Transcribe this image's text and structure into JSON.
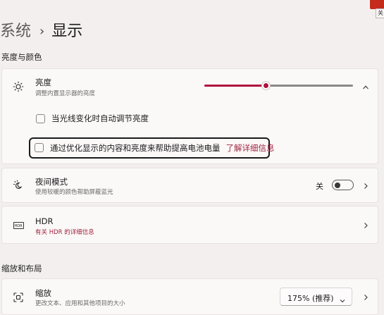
{
  "window": {
    "mini_label": "关"
  },
  "breadcrumb": {
    "parent": "系统",
    "separator": "›",
    "current": "显示"
  },
  "sections": {
    "brightness_color": "亮度与颜色",
    "scale_layout": "缩放和布局"
  },
  "brightness": {
    "title": "亮度",
    "subtitle": "调整内置显示器的亮度",
    "level_percent": 41,
    "auto_adjust_label": "当光线变化时自动调节亮度",
    "auto_adjust_checked": false,
    "battery_optimize_label": "通过优化显示的内容和亮度来帮助提高电池电量",
    "battery_optimize_checked": false,
    "learn_more": "了解详细信息"
  },
  "night_light": {
    "title": "夜间模式",
    "subtitle": "使用较暖的颜色帮助屏蔽蓝光",
    "state_label": "关",
    "enabled": false
  },
  "hdr": {
    "title": "HDR",
    "subtitle": "有关 HDR 的详细信息",
    "badge": "HDR"
  },
  "scale": {
    "title": "缩放",
    "subtitle": "更改文本、应用和其他项目的大小",
    "selected": "175% (推荐)"
  },
  "colors": {
    "accent": "#b0123f",
    "link": "#a1263f",
    "close": "#c42b1c",
    "background": "#f4efef",
    "card": "#fbf8f8"
  }
}
